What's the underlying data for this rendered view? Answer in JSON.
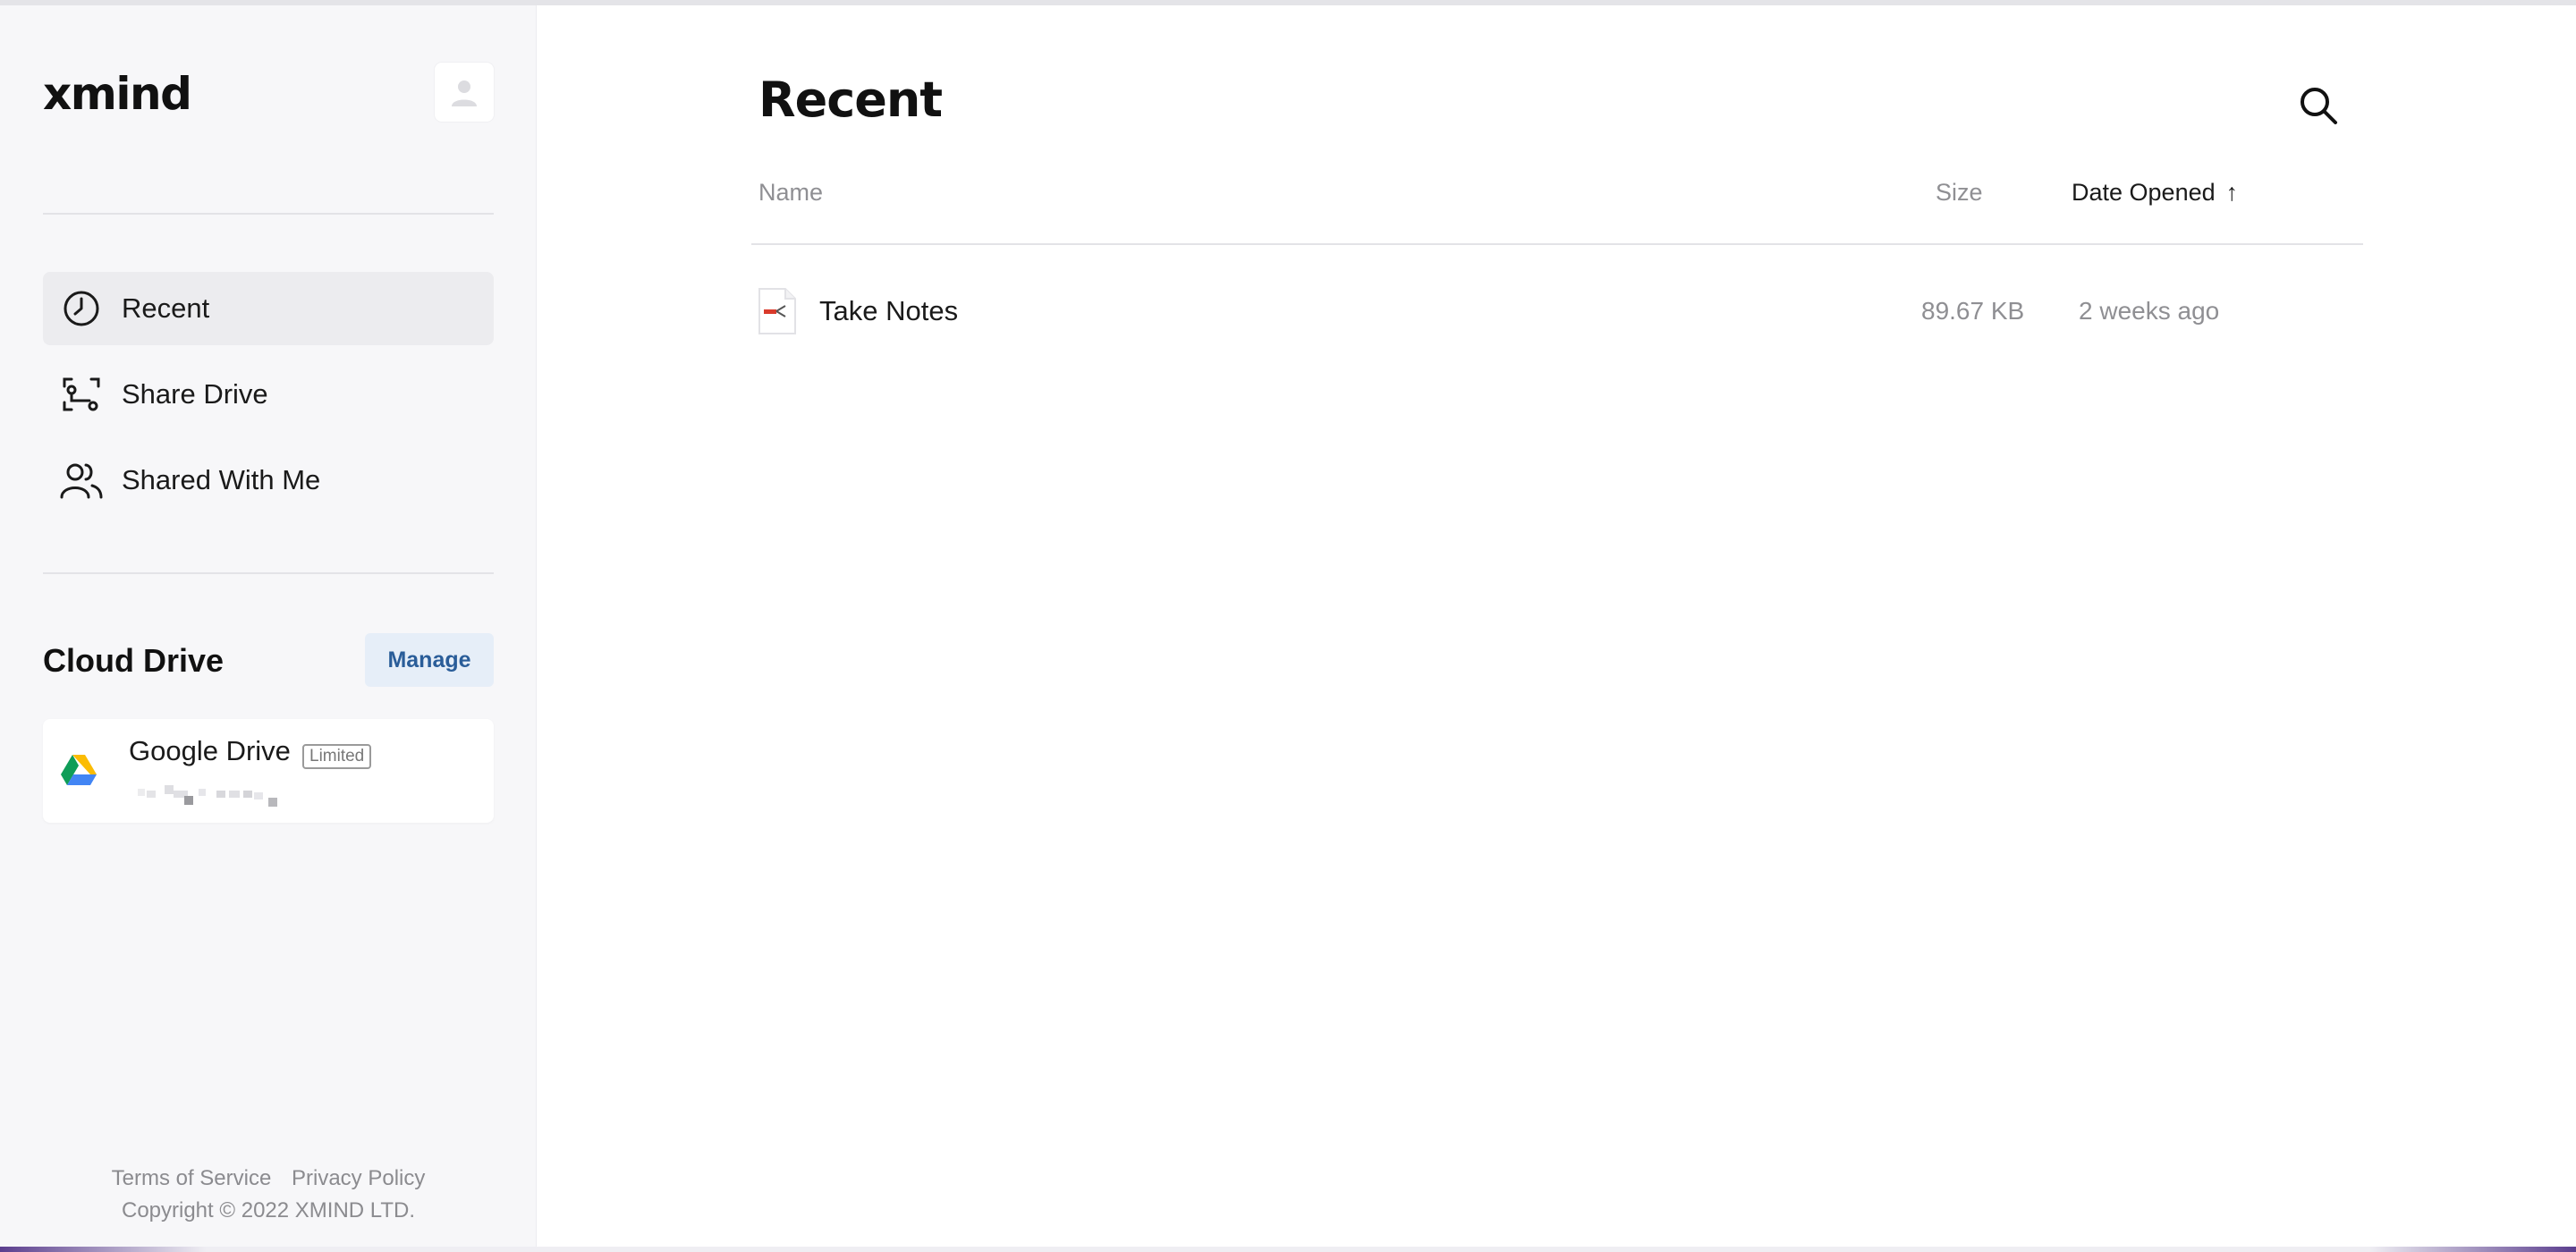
{
  "app": {
    "logo": "xmind"
  },
  "sidebar": {
    "nav": [
      {
        "label": "Recent",
        "icon": "clock-icon",
        "active": true
      },
      {
        "label": "Share Drive",
        "icon": "share-drive-icon",
        "active": false
      },
      {
        "label": "Shared With Me",
        "icon": "people-icon",
        "active": false
      }
    ],
    "cloud_drive": {
      "title": "Cloud Drive",
      "manage_label": "Manage",
      "accounts": [
        {
          "name": "Google Drive",
          "badge": "Limited",
          "icon": "google-drive-icon"
        }
      ]
    },
    "footer": {
      "terms": "Terms of Service",
      "privacy": "Privacy Policy",
      "copyright": "Copyright © 2022 XMIND LTD."
    }
  },
  "main": {
    "title": "Recent",
    "columns": {
      "name": "Name",
      "size": "Size",
      "date": "Date Opened",
      "sort_indicator": "↑"
    },
    "files": [
      {
        "name": "Take Notes",
        "size": "89.67 KB",
        "date": "2 weeks ago",
        "icon": "xmind-file-icon"
      }
    ]
  },
  "colors": {
    "sidebar_bg": "#f7f7f9",
    "active_nav_bg": "#ececef",
    "manage_bg": "#e6eef8",
    "manage_text": "#2a5d99",
    "muted_text": "#8f8f93"
  }
}
